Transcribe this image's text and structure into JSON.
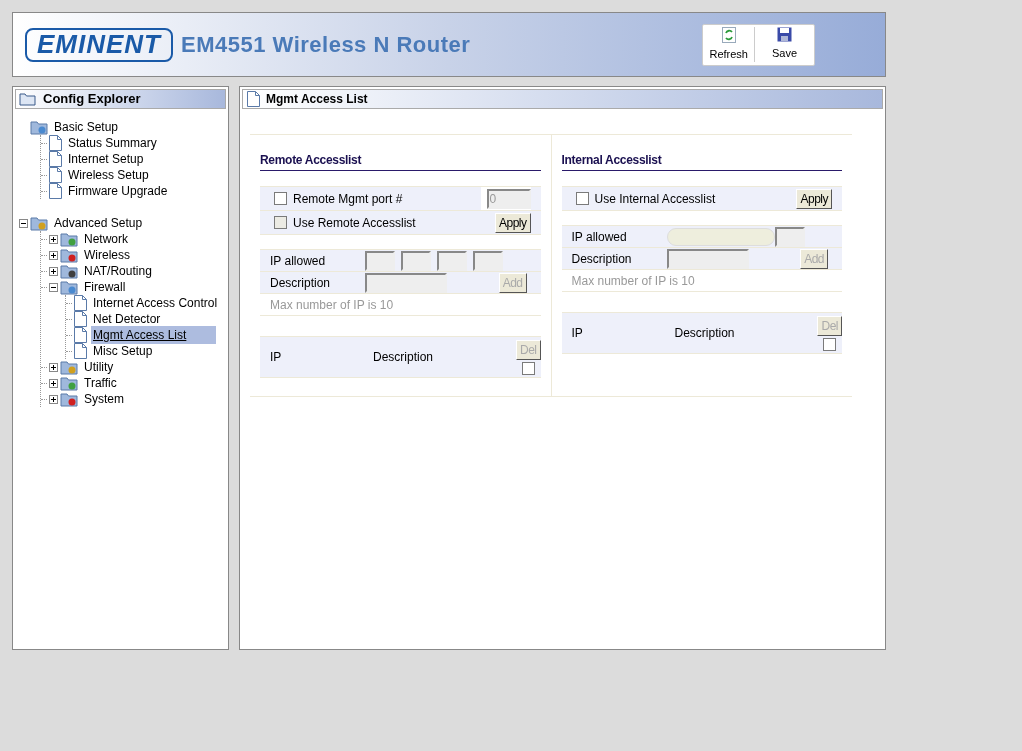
{
  "header": {
    "brand": "EMINENT",
    "title": "EM4551 Wireless N Router",
    "toolbar": [
      {
        "label": "Refresh"
      },
      {
        "label": "Save"
      }
    ]
  },
  "sidebar": {
    "title": "Config Explorer",
    "tree": [
      {
        "label": "Basic Setup",
        "selected": false,
        "children": [
          {
            "label": "Status Summary",
            "selected": false
          },
          {
            "label": "Internet Setup",
            "selected": false
          },
          {
            "label": "Wireless Setup",
            "selected": false
          },
          {
            "label": "Firmware Upgrade",
            "selected": false
          }
        ]
      },
      {
        "label": "Advanced Setup",
        "selected": false,
        "expanded": true,
        "children": [
          {
            "label": "Network",
            "selected": false,
            "expanded": false
          },
          {
            "label": "Wireless",
            "selected": false,
            "expanded": false
          },
          {
            "label": "NAT/Routing",
            "selected": false,
            "expanded": false
          },
          {
            "label": "Firewall",
            "selected": false,
            "expanded": true,
            "children": [
              {
                "label": "Internet Access Control",
                "selected": false
              },
              {
                "label": "Net Detector",
                "selected": false
              },
              {
                "label": "Mgmt Access List",
                "selected": true
              },
              {
                "label": "Misc Setup",
                "selected": false
              }
            ]
          },
          {
            "label": "Utility",
            "selected": false,
            "expanded": false
          },
          {
            "label": "Traffic",
            "selected": false,
            "expanded": false
          },
          {
            "label": "System",
            "selected": false,
            "expanded": false
          }
        ]
      }
    ]
  },
  "panel": {
    "title": "Mgmt Access List",
    "sections": [
      {
        "heading": "Remote Accesslist",
        "options": [
          {
            "kind": "port",
            "label": "Remote Mgmt port #",
            "checked": false,
            "disabled": false,
            "value": "0"
          },
          {
            "kind": "apply",
            "label": "Use Remote Accesslist",
            "checked": false,
            "disabled": true,
            "button": "Apply"
          }
        ],
        "ip_label": "IP allowed",
        "ip_field": {
          "kind": "octets"
        },
        "description_label": "Description",
        "add_button": "Add",
        "note": "Max number of IP is 10",
        "columns": [
          "IP",
          "Description"
        ],
        "del_button": "Del",
        "del_checked": false
      },
      {
        "heading": "Internal Accesslist",
        "options": [
          {
            "kind": "apply",
            "label": "Use Internal Accesslist",
            "checked": false,
            "disabled": false,
            "button": "Apply"
          }
        ],
        "ip_label": "IP allowed",
        "ip_field": {
          "kind": "combined"
        },
        "description_label": "Description",
        "add_button": "Add",
        "note": "Max number of IP is 10",
        "columns": [
          "IP",
          "Description"
        ],
        "del_button": "Del",
        "del_checked": false
      }
    ]
  }
}
